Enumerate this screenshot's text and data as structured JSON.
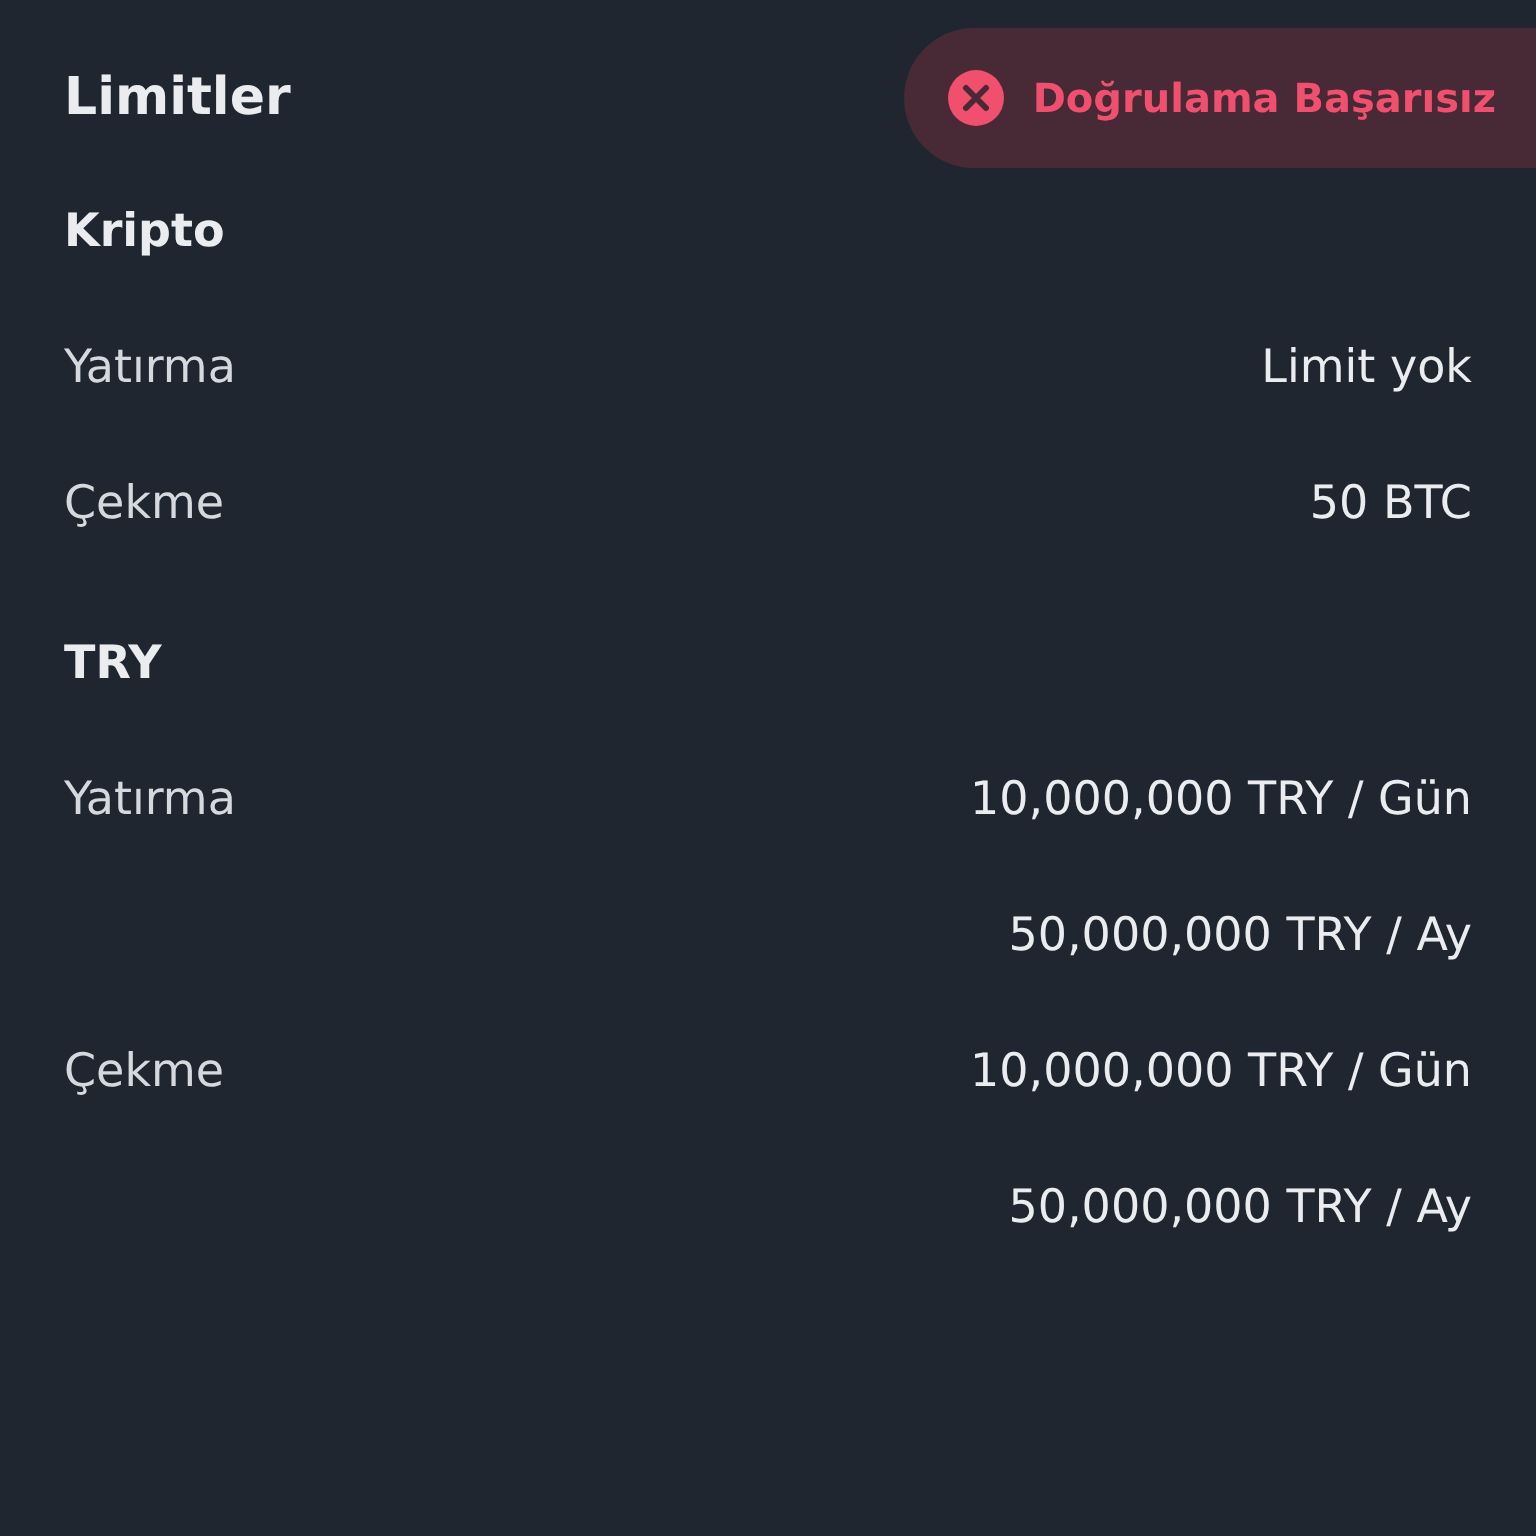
{
  "title": "Limitler",
  "status": {
    "label": "Doğrulama Başarısız",
    "kind": "failed"
  },
  "sections": [
    {
      "title": "Kripto",
      "rows": [
        {
          "label": "Yatırma",
          "values": [
            "Limit yok"
          ]
        },
        {
          "label": "Çekme",
          "values": [
            "50 BTC"
          ]
        }
      ]
    },
    {
      "title": "TRY",
      "rows": [
        {
          "label": "Yatırma",
          "values": [
            "10,000,000 TRY / Gün",
            "50,000,000 TRY / Ay"
          ]
        },
        {
          "label": "Çekme",
          "values": [
            "10,000,000 TRY / Gün",
            "50,000,000 TRY / Ay"
          ]
        }
      ]
    }
  ]
}
